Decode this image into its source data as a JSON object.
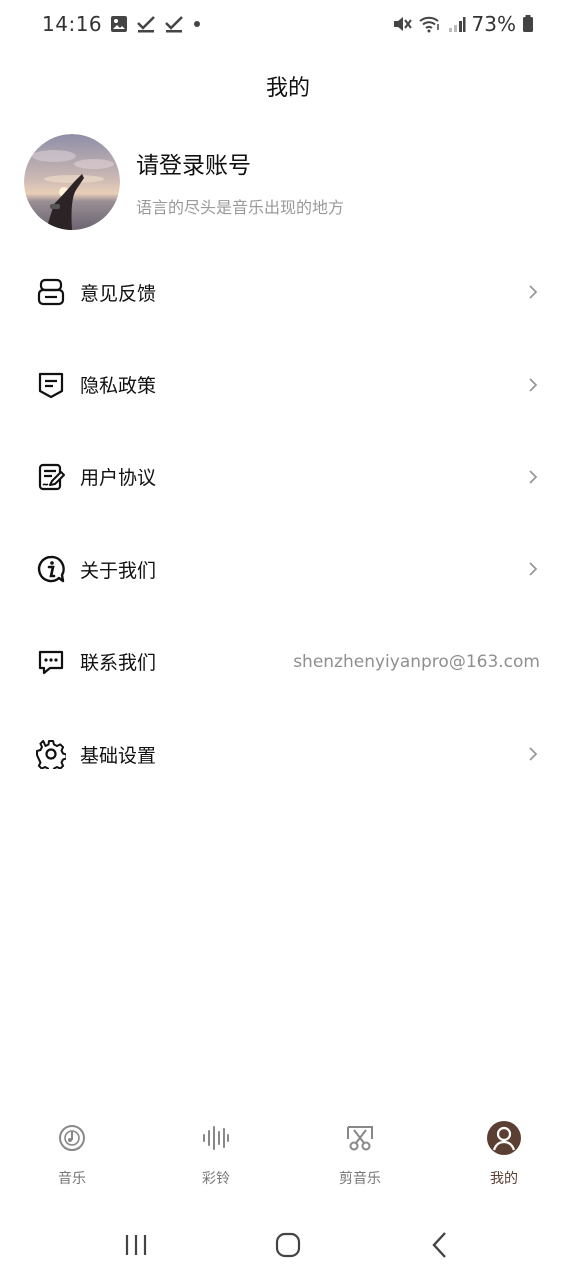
{
  "status_bar": {
    "time": "14:16",
    "battery": "73%"
  },
  "page": {
    "title": "我的"
  },
  "profile": {
    "name": "请登录账号",
    "slogan": "语言的尽头是音乐出现的地方"
  },
  "menu": {
    "items": [
      {
        "label": "意见反馈",
        "icon": "feedback-icon"
      },
      {
        "label": "隐私政策",
        "icon": "privacy-icon"
      },
      {
        "label": "用户协议",
        "icon": "agreement-icon"
      },
      {
        "label": "关于我们",
        "icon": "info-icon"
      },
      {
        "label": "联系我们",
        "icon": "chat-icon",
        "value": "shenzhenyiyanpro@163.com"
      },
      {
        "label": "基础设置",
        "icon": "gear-icon"
      }
    ]
  },
  "tabs": [
    {
      "label": "音乐",
      "icon": "music-disc-icon"
    },
    {
      "label": "彩铃",
      "icon": "waveform-icon"
    },
    {
      "label": "剪音乐",
      "icon": "scissors-icon"
    },
    {
      "label": "我的",
      "icon": "user-icon",
      "active": true
    }
  ],
  "colors": {
    "accent": "#5b3f33",
    "text_primary": "#111111",
    "text_secondary": "#9a9a9a",
    "icon_inactive": "#888888"
  }
}
